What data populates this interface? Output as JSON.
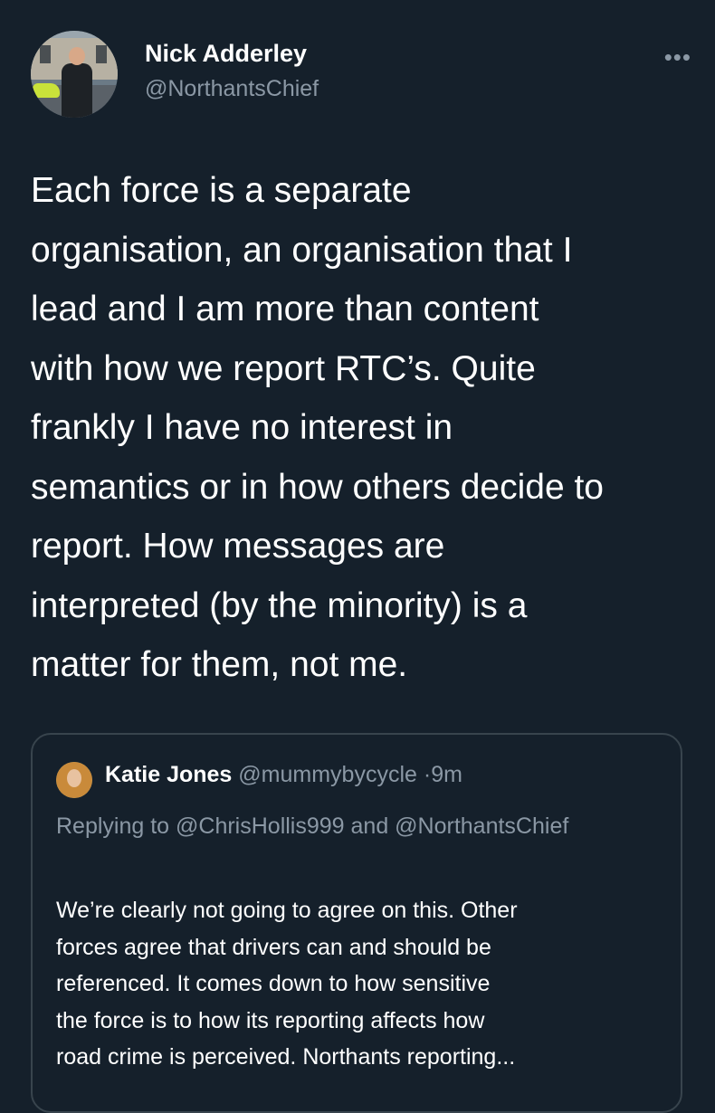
{
  "tweet": {
    "author_name": "Nick Adderley",
    "author_handle": "@NorthantsChief",
    "more_icon": "ellipsis-icon",
    "text": "Each force is a separate\norganisation, an organisation that I\nlead and I am more than content\nwith how we report RTC’s. Quite\nfrankly I have no interest in\nsemantics or in how others decide to\nreport. How messages are\ninterpreted (by the minority) is a\nmatter for them, not me."
  },
  "quoted": {
    "author_name": "Katie Jones",
    "author_handle": "@mummybycycle",
    "separator": "·",
    "time": "9m",
    "replying_to": "Replying to @ChrisHollis999 and @NorthantsChief",
    "text": "We’re clearly not going to agree on this. Other\nforces agree that drivers can and should be\nreferenced.  It comes down to how sensitive\nthe force is to how its reporting affects how\nroad crime is perceived. Northants reporting..."
  },
  "colors": {
    "background": "#15202b",
    "primary_text": "#ffffff",
    "secondary_text": "#8b98a5",
    "border": "#38444d"
  }
}
